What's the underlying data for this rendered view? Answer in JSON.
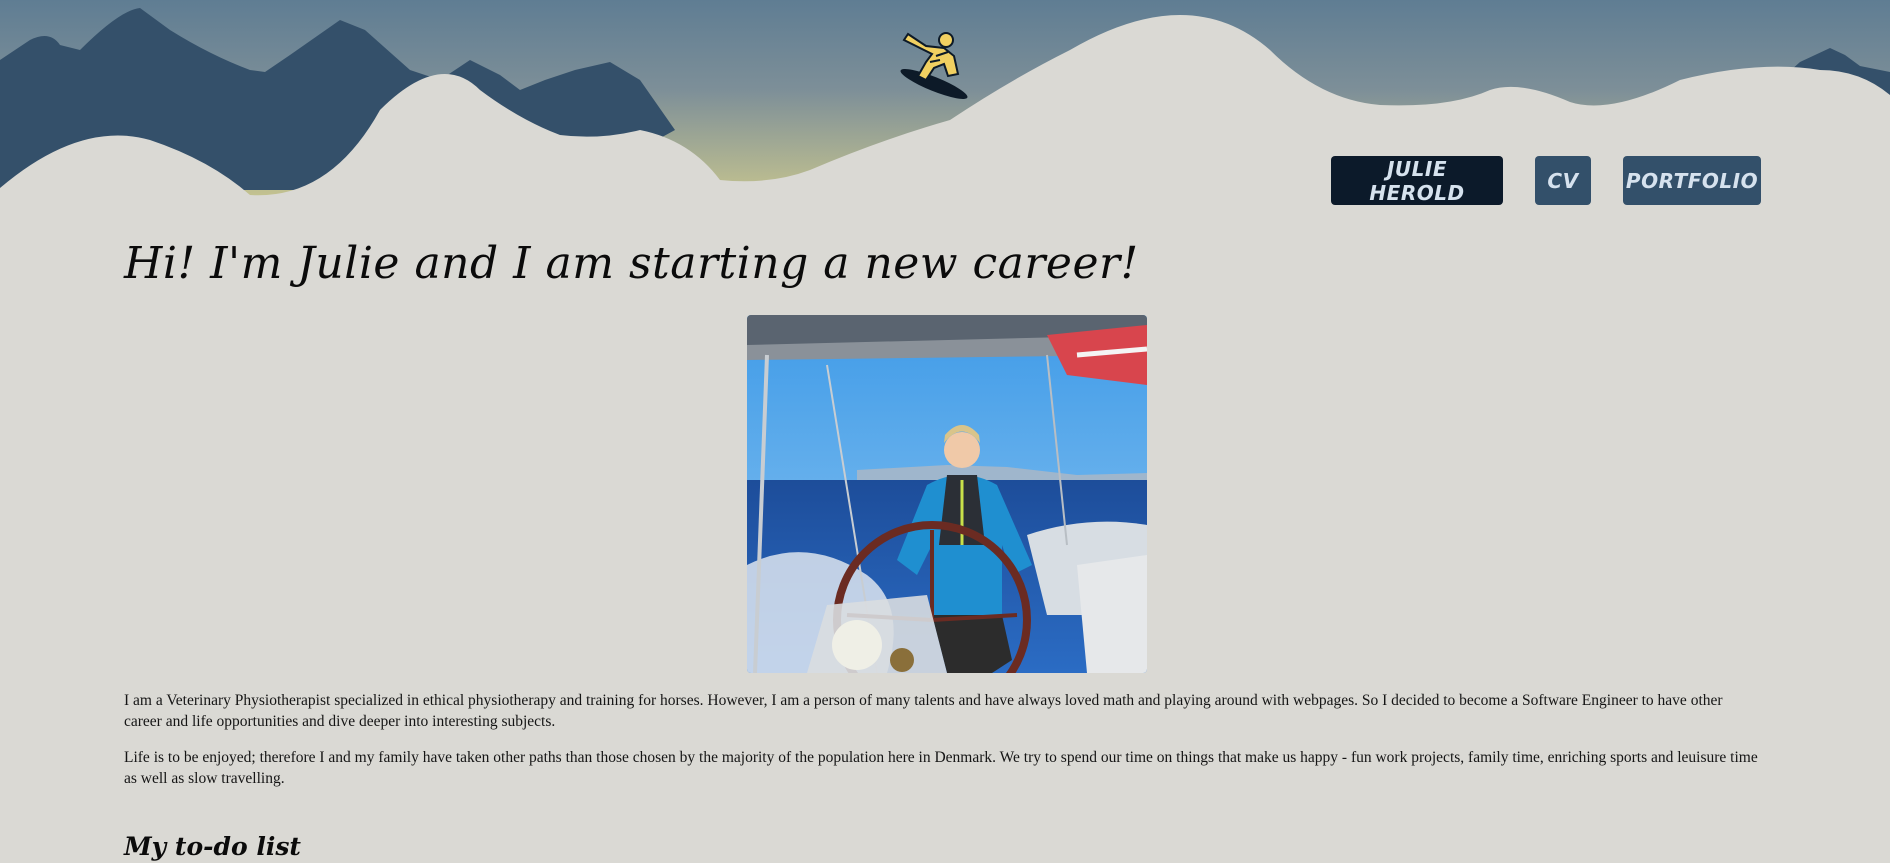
{
  "nav": {
    "items": [
      {
        "label": "JULIE HEROLD",
        "active": true
      },
      {
        "label": "CV",
        "active": false
      },
      {
        "label": "PORTFOLIO",
        "active": false
      }
    ]
  },
  "hero": {
    "title": "Hi! I'm Julie and I am starting a new career!"
  },
  "content": {
    "paragraph1": "I am a Veterinary Physiotherapist specialized in ethical physiotherapy and training for horses. However, I am a person of many talents and have always loved math and playing around with webpages. So I decided to become a Software Engineer to have other career and life opportunities and dive deeper into interesting subjects.",
    "paragraph2": "Life is to be enjoyed; therefore I and my family have taken other paths than those chosen by the majority of the population here in Denmark. We try to spend our time on things that make us happy - fun work projects, family time, enriching sports and leuisure time as well as slow travelling.",
    "todo_heading": "My to-do list"
  },
  "colors": {
    "background": "#dad9d4",
    "sky_top": "#5f7d93",
    "sky_bottom": "#c6c48f",
    "mountain_dark": "#34506a",
    "snow": "#dad9d4",
    "nav_active": "#0c1a2a",
    "nav_default": "#33506a",
    "snowboarder": "#f1d061"
  }
}
